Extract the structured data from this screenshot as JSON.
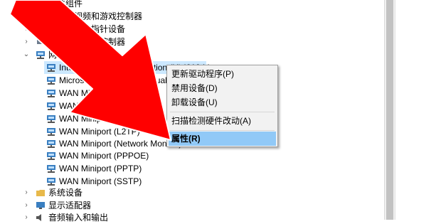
{
  "tree": {
    "items": [
      {
        "label": "软件组件",
        "chevron": "›",
        "icon": "component-icon"
      },
      {
        "label": "声音、视频和游戏控制器",
        "chevron": "›",
        "icon": "speaker-icon"
      },
      {
        "label": "鼠标和其他指针设备",
        "chevron": "›",
        "icon": "mouse-icon"
      },
      {
        "label": "通用串行总线控制器",
        "chevron": "›",
        "icon": "usb-icon"
      },
      {
        "label": "网络适配器",
        "chevron": "⌄",
        "icon": "network-adapter-icon"
      },
      {
        "label": "Intel(R) Ethernet Connection (H) I219-V",
        "icon": "network-adapter-icon"
      },
      {
        "label": "Microsoft Wi-Fi Direct Virtual Adapter",
        "icon": "network-adapter-icon"
      },
      {
        "label": "WAN Miniport (IKEv2)",
        "icon": "network-adapter-icon"
      },
      {
        "label": "WAN Miniport (IP)",
        "icon": "network-adapter-icon"
      },
      {
        "label": "WAN Miniport (IPv6)",
        "icon": "network-adapter-icon"
      },
      {
        "label": "WAN Miniport (L2TP)",
        "icon": "network-adapter-icon"
      },
      {
        "label": "WAN Miniport (Network Monitor)",
        "icon": "network-adapter-icon"
      },
      {
        "label": "WAN Miniport (PPPOE)",
        "icon": "network-adapter-icon"
      },
      {
        "label": "WAN Miniport (PPTP)",
        "icon": "network-adapter-icon"
      },
      {
        "label": "WAN Miniport (SSTP)",
        "icon": "network-adapter-icon"
      },
      {
        "label": "系统设备",
        "chevron": "›",
        "icon": "folder-icon"
      },
      {
        "label": "显示适配器",
        "chevron": "›",
        "icon": "monitor-icon"
      },
      {
        "label": "音频输入和输出",
        "chevron": "›",
        "icon": "speaker-icon"
      }
    ]
  },
  "context_menu": {
    "items": [
      "更新驱动程序(P)",
      "禁用设备(D)",
      "卸载设备(U)",
      "扫描检测硬件改动(A)",
      "属性(R)"
    ]
  },
  "colors": {
    "arrow": "#ff0000",
    "highlight": "#cce8ff",
    "menu_active": "#91c9f7",
    "menu_bg": "#f2f2f2"
  }
}
